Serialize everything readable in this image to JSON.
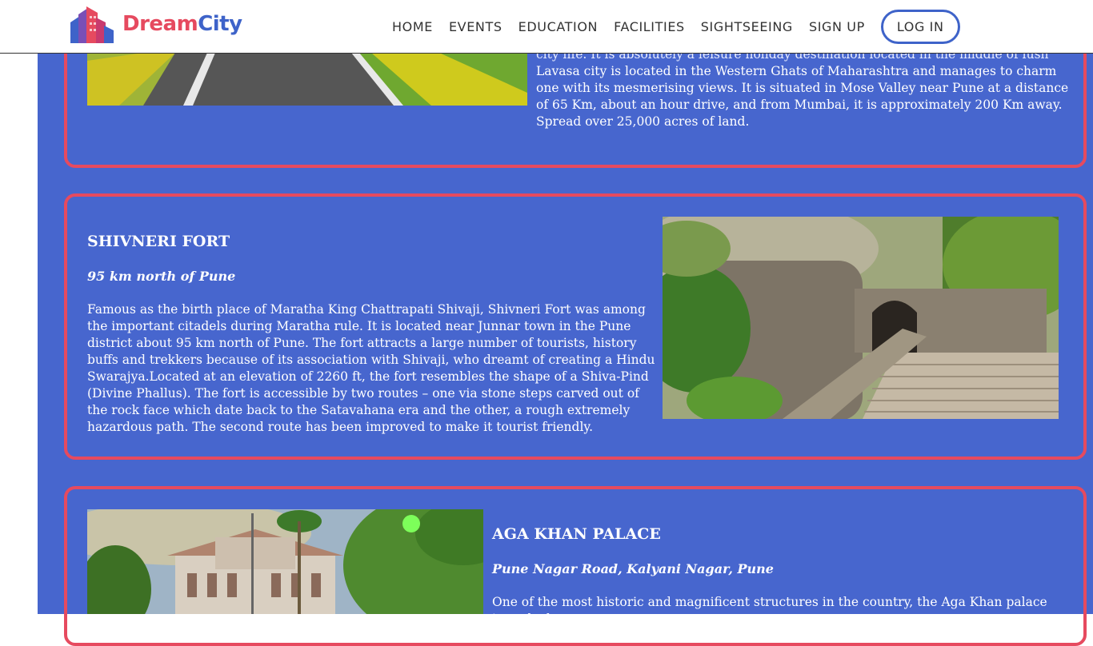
{
  "brand": {
    "dream": "Dream",
    "city": "City"
  },
  "nav": {
    "items": [
      "HOME",
      "EVENTS",
      "EDUCATION",
      "FACILITIES",
      "SIGHTSEEING",
      "SIGN UP"
    ],
    "login": "LOG IN"
  },
  "colors": {
    "accent_red": "#e64a5f",
    "page_blue": "#4766ce",
    "brand_blue": "#3e63c9"
  },
  "cards": [
    {
      "body_partial_top": "city life. It is absolutely a leisure holiday destination located in the middle of lush green hills.",
      "body": "Lavasa city is located in the Western Ghats of Maharashtra and manages to charm one with its mesmerising views. It is situated in Mose Valley near Pune at a distance of 65 Km, about an hour drive, and from Mumbai, it is approximately 200 Km away. Spread over 25,000 acres of land."
    },
    {
      "title": "SHIVNERI FORT",
      "subtitle": "95 km north of Pune",
      "body": "Famous as the birth place of Maratha King Chattrapati Shivaji, Shivneri Fort was among the important citadels during Maratha rule. It is located near Junnar town in the Pune district about 95 km north of Pune. The fort attracts a large number of tourists, history buffs and trekkers because of its association with Shivaji, who dreamt of creating a Hindu Swarajya.Located at an elevation of 2260 ft, the fort resembles the shape of a Shiva-Pind (Divine Phallus). The fort is accessible by two routes – one via stone steps carved out of the rock face which date back to the Satavahana era and the other, a rough extremely hazardous path. The second route has been improved to make it tourist friendly."
    },
    {
      "title": "AGA KHAN PALACE",
      "subtitle": "Pune Nagar Road, Kalyani Nagar, Pune",
      "body": "One of the most historic and magnificent structures in the country, the Aga Khan palace is ranked"
    }
  ]
}
